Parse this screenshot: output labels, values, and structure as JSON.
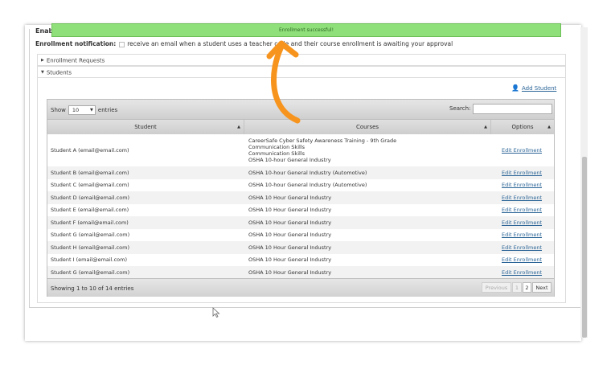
{
  "toast": {
    "text": "Enrollment successful!",
    "color": "#8fdf7a"
  },
  "header": {
    "partial_label": "Enabl"
  },
  "notification": {
    "label": "Enrollment notification:",
    "text": "receive an email when a student uses a teacher code and their course enrollment is awaiting your approval"
  },
  "accordion": {
    "enrollment_requests": "Enrollment Requests",
    "students": "Students"
  },
  "add_student": "Add Student",
  "table": {
    "show_label": "Show",
    "entries_label": "entries",
    "page_size": "10",
    "search_label": "Search:",
    "columns": [
      "Student",
      "Courses",
      "Options"
    ],
    "rows": [
      {
        "student": "Student A (email@email.com)",
        "courses": [
          "CareerSafe Cyber Safety Awareness Training - 9th Grade",
          "Communication Skills",
          "Communication Skills",
          "OSHA 10-hour General Industry"
        ],
        "option": "Edit Enrollment"
      },
      {
        "student": "Student B (email@email.com)",
        "courses": [
          "OSHA 10-hour General Industry (Automotive)"
        ],
        "option": "Edit Enrollment"
      },
      {
        "student": "Student C (email@email.com)",
        "courses": [
          "OSHA 10-hour General Industry (Automotive)"
        ],
        "option": "Edit Enrollment"
      },
      {
        "student": "Student D (email@email.com)",
        "courses": [
          "OSHA 10 Hour General Industry"
        ],
        "option": "Edit Enrollment"
      },
      {
        "student": "Student E (email@email.com)",
        "courses": [
          "OSHA 10 Hour General Industry"
        ],
        "option": "Edit Enrollment"
      },
      {
        "student": "Student F (email@email.com)",
        "courses": [
          "OSHA 10 Hour General Industry"
        ],
        "option": "Edit Enrollment"
      },
      {
        "student": "Student G (email@email.com)",
        "courses": [
          "OSHA 10 Hour General Industry"
        ],
        "option": "Edit Enrollment"
      },
      {
        "student": "Student H (email@email.com)",
        "courses": [
          "OSHA 10 Hour General Industry"
        ],
        "option": "Edit Enrollment"
      },
      {
        "student": "Student I (email@email.com)",
        "courses": [
          "OSHA 10 Hour General Industry"
        ],
        "option": "Edit Enrollment"
      },
      {
        "student": "Student G (email@email.com)",
        "courses": [
          "OSHA 10 Hour General Industry"
        ],
        "option": "Edit Enrollment"
      }
    ],
    "info": "Showing 1 to 10 of 14 entries",
    "pagination": {
      "previous": "Previous",
      "pages": [
        "1",
        "2"
      ],
      "current_page": "2",
      "next": "Next"
    }
  },
  "colors": {
    "link": "#2a6496",
    "annotation_arrow": "#f7941d",
    "toast_bg": "#8fdf7a"
  },
  "icons": {
    "add_student": "user-plus-icon",
    "annotation": "curved-arrow-icon",
    "cursor": "mouse-pointer-icon"
  }
}
